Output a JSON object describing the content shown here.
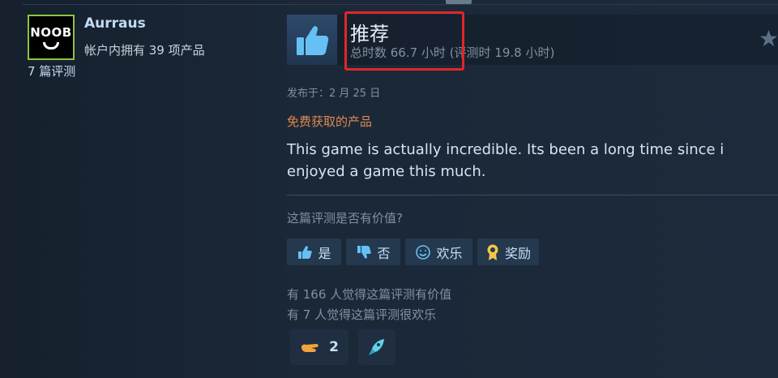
{
  "user": {
    "avatar_text": "NOOB",
    "name": "Aurraus",
    "owned": "帐户内拥有 39 项产品",
    "reviews": "7 篇评测"
  },
  "review": {
    "verdict": "推荐",
    "hours": "总时数 66.7 小时 (评测时 19.8 小时)",
    "posted": "发布于：2 月 25 日",
    "free_product": "免费获取的产品",
    "body": "This game is actually incredible. Its been a long time since i enjoyed a game this much.",
    "helpful_question": "这篇评测是否有价值?",
    "buttons": {
      "yes": "是",
      "no": "否",
      "funny": "欢乐",
      "award": "奖励"
    },
    "helpful_count": "有 166 人觉得这篇评测有价值",
    "funny_count": "有 7 人觉得这篇评测很欢乐",
    "awards": [
      {
        "icon": "hand-award-icon",
        "count": "2"
      },
      {
        "icon": "rocket-award-icon",
        "count": ""
      }
    ]
  },
  "colors": {
    "background": "#1b2838",
    "link": "#c1dbf4",
    "muted": "#8091a2",
    "free_label": "#e2884e",
    "highlight_box": "#e0262a",
    "avatar_border": "#8bc53f"
  }
}
